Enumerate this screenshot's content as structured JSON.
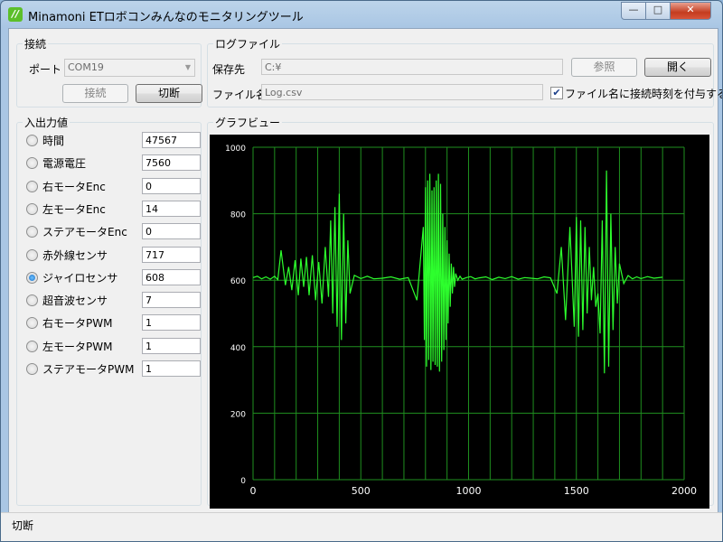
{
  "window": {
    "title": "Minamoni ETロボコンみんなのモニタリングツール",
    "app_icon_glyph": "//",
    "controls": {
      "minimize": "—",
      "maximize": "□",
      "close": "✕"
    }
  },
  "connection": {
    "group_title": "接続",
    "port_label": "ポート",
    "port_value": "COM19",
    "connect_label": "接続",
    "disconnect_label": "切断"
  },
  "logfile": {
    "group_title": "ログファイル",
    "save_dir_label": "保存先",
    "save_dir_value": "C:¥",
    "browse_label": "参照",
    "open_label": "開く",
    "filename_label": "ファイル名",
    "filename_value": "Log.csv",
    "timestamp_checkbox_label": "ファイル名に接続時刻を付与する",
    "timestamp_checked": true
  },
  "io": {
    "group_title": "入出力値",
    "items": [
      {
        "label": "時間",
        "value": "47567",
        "selected": false
      },
      {
        "label": "電源電圧",
        "value": "7560",
        "selected": false
      },
      {
        "label": "右モータEnc",
        "value": "0",
        "selected": false
      },
      {
        "label": "左モータEnc",
        "value": "14",
        "selected": false
      },
      {
        "label": "ステアモータEnc",
        "value": "0",
        "selected": false
      },
      {
        "label": "赤外線センサ",
        "value": "717",
        "selected": false
      },
      {
        "label": "ジャイロセンサ",
        "value": "608",
        "selected": true
      },
      {
        "label": "超音波センサ",
        "value": "7",
        "selected": false
      },
      {
        "label": "右モータPWM",
        "value": "1",
        "selected": false
      },
      {
        "label": "左モータPWM",
        "value": "1",
        "selected": false
      },
      {
        "label": "ステアモータPWM",
        "value": "1",
        "selected": false
      }
    ]
  },
  "graph": {
    "group_title": "グラフビュー"
  },
  "chart_data": {
    "type": "line",
    "xlim": [
      0,
      2000
    ],
    "ylim": [
      0,
      1000
    ],
    "xticks": [
      "0",
      "500",
      "1000",
      "1500",
      "2000"
    ],
    "yticks": [
      "0",
      "200",
      "400",
      "600",
      "800",
      "1000"
    ],
    "grid": true,
    "colors": {
      "background": "#000000",
      "grid": "#1f8f1f",
      "line": "#2dff2d",
      "text": "#ffffff"
    },
    "x": [
      0,
      20,
      40,
      60,
      80,
      100,
      115,
      130,
      150,
      165,
      180,
      195,
      210,
      222,
      235,
      248,
      260,
      275,
      290,
      305,
      320,
      335,
      350,
      360,
      370,
      380,
      390,
      400,
      410,
      420,
      430,
      440,
      450,
      470,
      500,
      530,
      560,
      600,
      640,
      680,
      720,
      760,
      790,
      795,
      800,
      805,
      810,
      815,
      820,
      825,
      830,
      835,
      840,
      845,
      850,
      855,
      860,
      865,
      870,
      875,
      880,
      885,
      890,
      895,
      900,
      905,
      910,
      915,
      920,
      925,
      930,
      935,
      940,
      950,
      960,
      970,
      990,
      1010,
      1030,
      1050,
      1080,
      1110,
      1140,
      1170,
      1200,
      1230,
      1260,
      1290,
      1320,
      1350,
      1380,
      1410,
      1430,
      1450,
      1470,
      1490,
      1500,
      1510,
      1520,
      1530,
      1540,
      1550,
      1560,
      1570,
      1580,
      1590,
      1600,
      1610,
      1620,
      1630,
      1640,
      1650,
      1660,
      1670,
      1680,
      1690,
      1700,
      1720,
      1740,
      1760,
      1780,
      1800,
      1830,
      1860,
      1900,
      1950,
      2000
    ],
    "values": [
      608,
      612,
      604,
      610,
      603,
      612,
      602,
      690,
      585,
      640,
      570,
      660,
      555,
      665,
      580,
      670,
      555,
      675,
      540,
      655,
      530,
      700,
      550,
      780,
      500,
      820,
      460,
      860,
      420,
      800,
      470,
      720,
      560,
      615,
      605,
      612,
      604,
      606,
      610,
      603,
      608,
      540,
      760,
      420,
      880,
      340,
      900,
      360,
      920,
      330,
      870,
      355,
      880,
      345,
      900,
      340,
      920,
      325,
      890,
      355,
      800,
      390,
      760,
      420,
      720,
      470,
      680,
      520,
      650,
      560,
      640,
      580,
      620,
      600,
      612,
      603,
      608,
      611,
      604,
      607,
      610,
      602,
      609,
      605,
      611,
      603,
      608,
      606,
      604,
      610,
      607,
      560,
      700,
      480,
      760,
      460,
      790,
      430,
      780,
      450,
      760,
      500,
      700,
      540,
      640,
      520,
      560,
      440,
      780,
      320,
      930,
      340,
      800,
      450,
      700,
      530,
      650,
      590,
      614,
      604,
      610,
      605,
      611,
      606,
      609
    ]
  },
  "status": {
    "text": "切断"
  }
}
